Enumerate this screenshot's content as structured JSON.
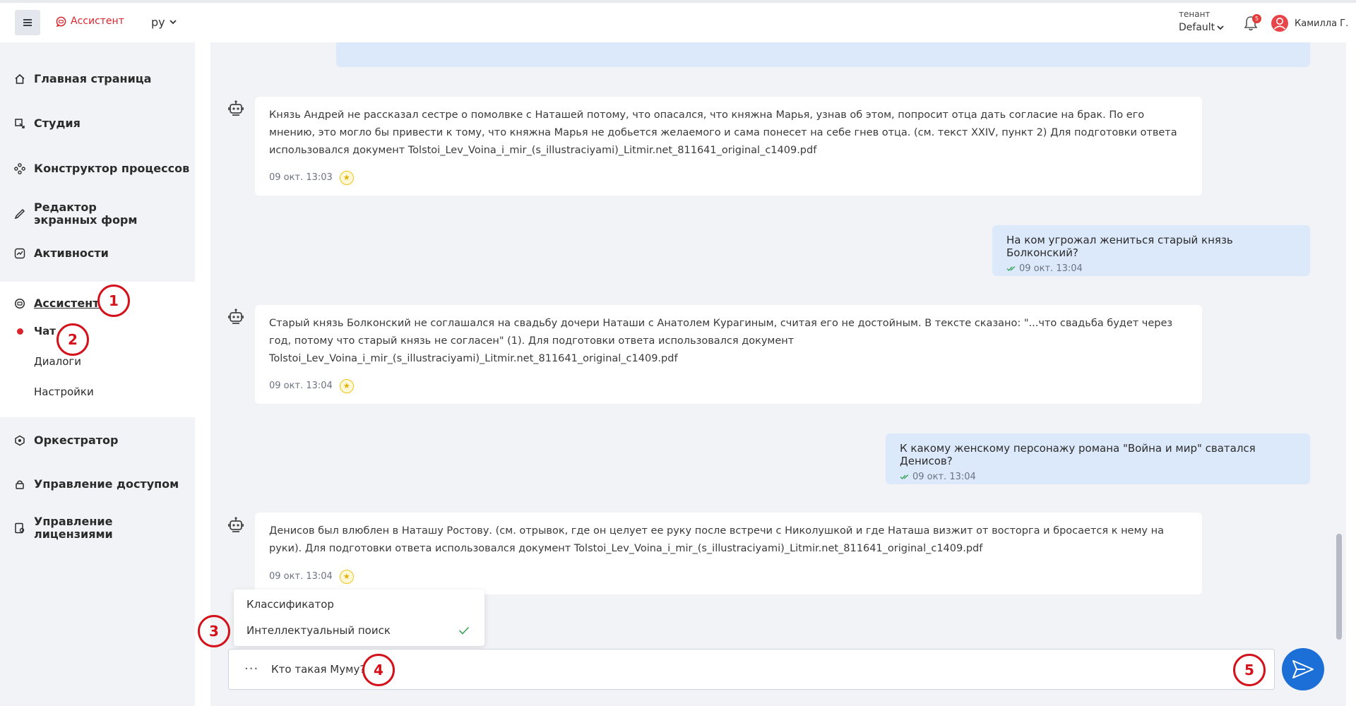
{
  "header": {
    "logo_text": "Ассистент",
    "language": "ру",
    "tenant_label": "тенант",
    "tenant_value": "Default",
    "notification_count": "5",
    "user_name": "Камилла Г."
  },
  "sidebar": {
    "items": [
      {
        "label": "Главная страница"
      },
      {
        "label": "Студия"
      },
      {
        "label": "Конструктор процессов"
      },
      {
        "label": "Редактор экранных форм"
      },
      {
        "label": "Активности"
      },
      {
        "label": "Ассистент"
      },
      {
        "label": "Оркестратор"
      },
      {
        "label": "Управление доступом"
      },
      {
        "label": "Управление лицензиями"
      }
    ],
    "assistant_sub": [
      {
        "label": "Чат"
      },
      {
        "label": "Диалоги"
      },
      {
        "label": "Настройки"
      }
    ]
  },
  "chat": {
    "messages": [
      {
        "role": "bot",
        "text": "Князь Андрей не рассказал сестре о помолвке с Наташей потому, что опасался, что княжна Марья, узнав об этом, попросит отца дать согласие на брак. По его мнению, это могло бы привести к тому, что княжна Марья не добьется желаемого и сама понесет на себе гнев отца. (см. текст XXIV, пункт 2) Для подготовки ответа использовался документ Tolstoi_Lev_Voina_i_mir_(s_illustraciyami)_Litmir.net_811641_original_c1409.pdf",
        "time": "09 окт. 13:03"
      },
      {
        "role": "user",
        "text": "На ком угрожал жениться старый князь Болконский?",
        "time": "09 окт. 13:04"
      },
      {
        "role": "bot",
        "text": "Старый князь Болконский не соглашался на свадьбу дочери Наташи с Анатолем Курагиным, считая его не достойным. В тексте сказано: \"...что свадьба будет через год, потому что старый князь не согласен\" (1). Для подготовки ответа использовался документ Tolstoi_Lev_Voina_i_mir_(s_illustraciyami)_Litmir.net_811641_original_c1409.pdf",
        "time": "09 окт. 13:04"
      },
      {
        "role": "user",
        "text": "К какому женскому персонажу романа \"Война и мир\" сватался Денисов?",
        "time": "09 окт. 13:04"
      },
      {
        "role": "bot",
        "text": "Денисов был влюблен в Наташу Ростову. (см. отрывок, где он целует ее руку после встречи с Николушкой и где Наташа визжит от восторга и бросается к нему на руки). Для подготовки ответа использовался документ Tolstoi_Lev_Voina_i_mir_(s_illustraciyami)_Litmir.net_811641_original_c1409.pdf",
        "time": "09 окт. 13:04"
      }
    ]
  },
  "mode_menu": {
    "items": [
      {
        "label": "Классификатор"
      },
      {
        "label": "Интеллектуальный поиск"
      }
    ]
  },
  "input": {
    "more": "···",
    "value": "Кто такая Муму?"
  },
  "markers": [
    "1",
    "2",
    "3",
    "4",
    "5"
  ],
  "colors": {
    "brand": "#d9252d",
    "accent": "#1c6fd6",
    "user_bubble": "#dce9fa",
    "sidebar_bg": "#f2f3f6",
    "annotation": "#d3121b"
  }
}
